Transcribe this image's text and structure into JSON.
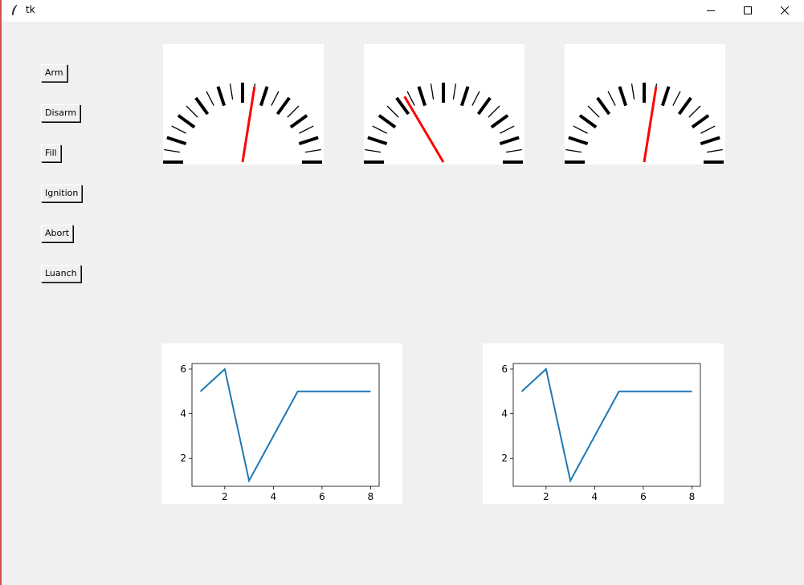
{
  "window": {
    "title": "tk",
    "controls": {
      "minimize": "minimize-icon",
      "maximize": "maximize-icon",
      "close": "close-icon"
    }
  },
  "buttons": [
    {
      "label": "Arm"
    },
    {
      "label": "Disarm"
    },
    {
      "label": "Fill"
    },
    {
      "label": "Ignition"
    },
    {
      "label": "Abort"
    },
    {
      "label": "Luanch"
    }
  ],
  "colors": {
    "needle": "#ff0000",
    "tick": "#000000",
    "line": "#1f77b4",
    "panel": "#ffffff",
    "background": "#f0f0f0"
  },
  "gauges": [
    {
      "value_fraction": 0.55
    },
    {
      "value_fraction": 0.33
    },
    {
      "value_fraction": 0.55
    }
  ],
  "chart_data": [
    {
      "type": "line",
      "x": [
        1,
        2,
        3,
        4,
        5,
        6,
        7,
        8
      ],
      "series": [
        {
          "values": [
            5,
            6,
            1,
            3,
            5,
            5,
            5,
            5
          ]
        }
      ],
      "xticks": [
        2,
        4,
        6,
        8
      ],
      "yticks": [
        2,
        4,
        6
      ],
      "xlim": [
        0.65,
        8.35
      ],
      "ylim": [
        0.75,
        6.25
      ],
      "grid": false,
      "title": "",
      "xlabel": "",
      "ylabel": ""
    },
    {
      "type": "line",
      "x": [
        1,
        2,
        3,
        4,
        5,
        6,
        7,
        8
      ],
      "series": [
        {
          "values": [
            5,
            6,
            1,
            3,
            5,
            5,
            5,
            5
          ]
        }
      ],
      "xticks": [
        2,
        4,
        6,
        8
      ],
      "yticks": [
        2,
        4,
        6
      ],
      "xlim": [
        0.65,
        8.35
      ],
      "ylim": [
        0.75,
        6.25
      ],
      "grid": false,
      "title": "",
      "xlabel": "",
      "ylabel": ""
    }
  ]
}
